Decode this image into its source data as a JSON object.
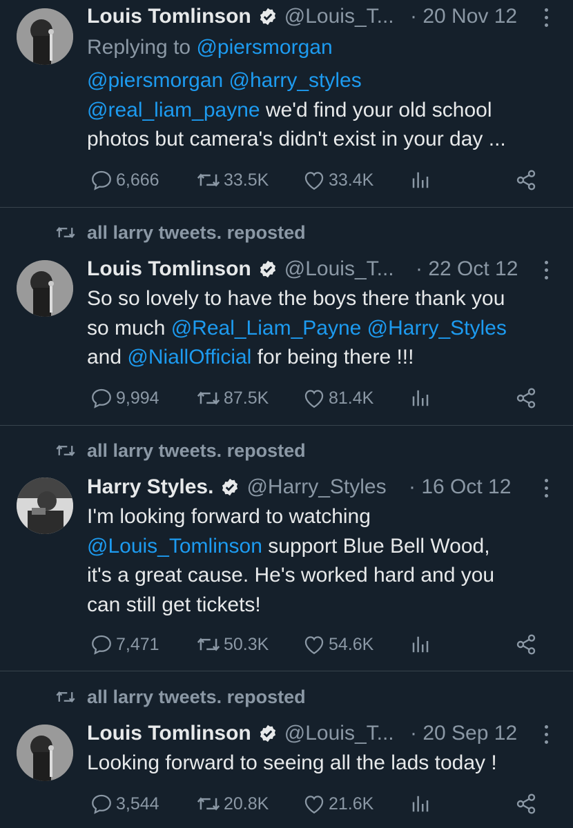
{
  "repost_label": "all larry tweets. reposted",
  "tweets": [
    {
      "name": "Louis Tomlinson",
      "handle": "@Louis_T...",
      "dot": "·",
      "date": "20 Nov 12",
      "replying_prefix": "Replying to",
      "replying_to": "@piersmorgan",
      "lines": [
        [
          {
            "t": "@piersmorgan @harry_styles",
            "m": true
          }
        ],
        [
          {
            "t": "@real_liam_payne",
            "m": true
          },
          {
            "t": " we'd find your old school",
            "m": false
          }
        ],
        [
          {
            "t": "photos but camera's didn't exist in your day ...",
            "m": false
          }
        ]
      ],
      "replies": "6,666",
      "reposts": "33.5K",
      "likes": "33.4K"
    },
    {
      "reposted_by": "all larry tweets. reposted",
      "name": "Louis Tomlinson",
      "handle": "@Louis_T...",
      "dot": "·",
      "date": "22 Oct 12",
      "lines": [
        [
          {
            "t": "So so lovely to have the boys there thank you",
            "m": false
          }
        ],
        [
          {
            "t": "so much ",
            "m": false
          },
          {
            "t": "@Real_Liam_Payne @Harry_Styles",
            "m": true
          }
        ],
        [
          {
            "t": "and ",
            "m": false
          },
          {
            "t": "@NiallOfficial",
            "m": true
          },
          {
            "t": " for being there !!!",
            "m": false
          }
        ]
      ],
      "replies": "9,994",
      "reposts": "87.5K",
      "likes": "81.4K"
    },
    {
      "reposted_by": "all larry tweets. reposted",
      "name": "Harry Styles.",
      "handle": "@Harry_Styles",
      "dot": "·",
      "date": "16 Oct 12",
      "lines": [
        [
          {
            "t": "I'm looking forward to watching",
            "m": false
          }
        ],
        [
          {
            "t": "@Louis_Tomlinson",
            "m": true
          },
          {
            "t": " support Blue Bell Wood,",
            "m": false
          }
        ],
        [
          {
            "t": "it's a great cause. He's worked hard and you",
            "m": false
          }
        ],
        [
          {
            "t": "can still get tickets!",
            "m": false
          }
        ]
      ],
      "replies": "7,471",
      "reposts": "50.3K",
      "likes": "54.6K"
    },
    {
      "reposted_by": "all larry tweets. reposted",
      "name": "Louis Tomlinson",
      "handle": "@Louis_T...",
      "dot": "·",
      "date": "20 Sep 12",
      "lines": [
        [
          {
            "t": "Looking forward to seeing all the lads today !",
            "m": false
          }
        ]
      ],
      "replies": "3,544",
      "reposts": "20.8K",
      "likes": "21.6K"
    }
  ],
  "colors": {
    "background": "#15202b",
    "text": "#e7e9ea",
    "secondary": "#8b98a5",
    "mention": "#1d9bf0",
    "divider": "#38444d"
  },
  "icons": [
    "reply-icon",
    "repost-icon",
    "like-icon",
    "views-icon",
    "share-icon",
    "verified-badge-icon",
    "more-options-icon",
    "avatar-photo"
  ]
}
